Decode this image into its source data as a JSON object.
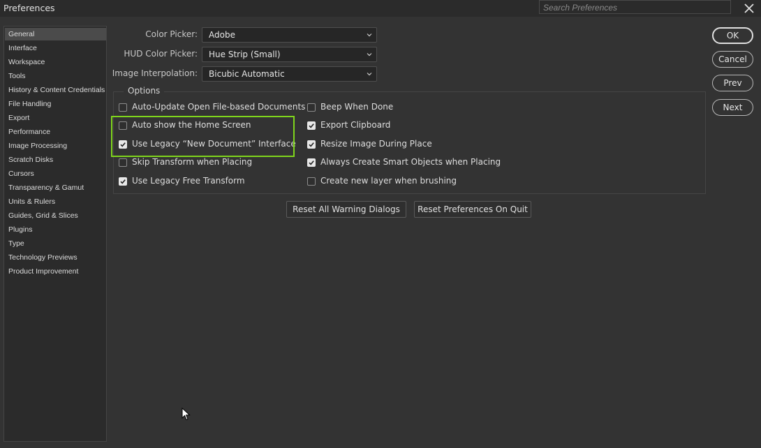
{
  "window": {
    "title": "Preferences",
    "search_placeholder": "Search Preferences"
  },
  "sidebar": {
    "items": [
      {
        "label": "General",
        "selected": true
      },
      {
        "label": "Interface"
      },
      {
        "label": "Workspace"
      },
      {
        "label": "Tools"
      },
      {
        "label": "History & Content Credentials"
      },
      {
        "label": "File Handling"
      },
      {
        "label": "Export"
      },
      {
        "label": "Performance"
      },
      {
        "label": "Image Processing"
      },
      {
        "label": "Scratch Disks"
      },
      {
        "label": "Cursors"
      },
      {
        "label": "Transparency & Gamut"
      },
      {
        "label": "Units & Rulers"
      },
      {
        "label": "Guides, Grid & Slices"
      },
      {
        "label": "Plugins"
      },
      {
        "label": "Type"
      },
      {
        "label": "Technology Previews"
      },
      {
        "label": "Product Improvement"
      }
    ]
  },
  "fields": {
    "color_picker": {
      "label": "Color Picker:",
      "value": "Adobe"
    },
    "hud_color_picker": {
      "label": "HUD Color Picker:",
      "value": "Hue Strip (Small)"
    },
    "image_interpolation": {
      "label": "Image Interpolation:",
      "value": "Bicubic Automatic"
    }
  },
  "options": {
    "title": "Options",
    "left": [
      {
        "label": "Auto-Update Open File-based Documents",
        "checked": false
      },
      {
        "label": "Auto show the Home Screen",
        "checked": false
      },
      {
        "label": "Use Legacy “New Document” Interface",
        "checked": true
      },
      {
        "label": "Skip Transform when Placing",
        "checked": false
      },
      {
        "label": "Use Legacy Free Transform",
        "checked": true
      }
    ],
    "right": [
      {
        "label": "Beep When Done",
        "checked": false
      },
      {
        "label": "Export Clipboard",
        "checked": true
      },
      {
        "label": "Resize Image During Place",
        "checked": true
      },
      {
        "label": "Always Create Smart Objects when Placing",
        "checked": true
      },
      {
        "label": "Create new layer when brushing",
        "checked": false
      }
    ]
  },
  "buttons": {
    "reset_warnings": "Reset All Warning Dialogs",
    "reset_prefs": "Reset Preferences On Quit",
    "ok": "OK",
    "cancel": "Cancel",
    "prev": "Prev",
    "next": "Next"
  },
  "colors": {
    "background": "#333333",
    "highlight_box": "#7fd61c"
  }
}
